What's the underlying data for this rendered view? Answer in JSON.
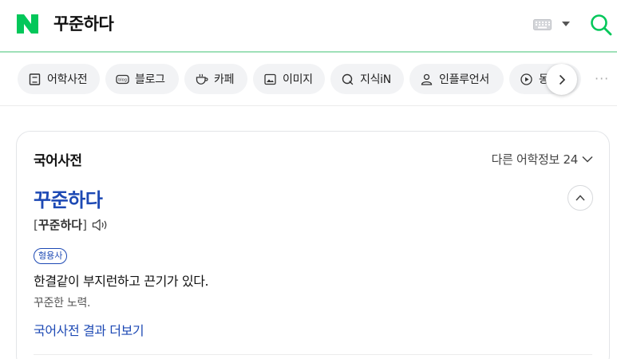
{
  "header": {
    "query": "꾸준하다",
    "logo_color": "#03c75a",
    "keyboard_icon": "keyboard-icon",
    "search_icon": "search-icon"
  },
  "tabs": [
    {
      "label": "어학사전",
      "icon": "book-icon"
    },
    {
      "label": "블로그",
      "icon": "blog-icon"
    },
    {
      "label": "카페",
      "icon": "cup-icon"
    },
    {
      "label": "이미지",
      "icon": "image-icon"
    },
    {
      "label": "지식iN",
      "icon": "q-icon"
    },
    {
      "label": "인플루언서",
      "icon": "person-icon"
    },
    {
      "label": "동",
      "icon": "play-icon"
    }
  ],
  "tabs_more": "···",
  "card": {
    "title": "국어사전",
    "other_info_label": "다른 어학정보 24",
    "entry": "꾸준하다",
    "pron_open": "[",
    "pron_text": "꾸준하다",
    "pron_close": "]",
    "pos": "형용사",
    "definition": "한결같이 부지런하고 끈기가 있다.",
    "example": "꾸준한 노력.",
    "more_link": "국어사전 결과 더보기"
  },
  "colors": {
    "accent": "#03c75a",
    "link": "#1d49b4"
  }
}
